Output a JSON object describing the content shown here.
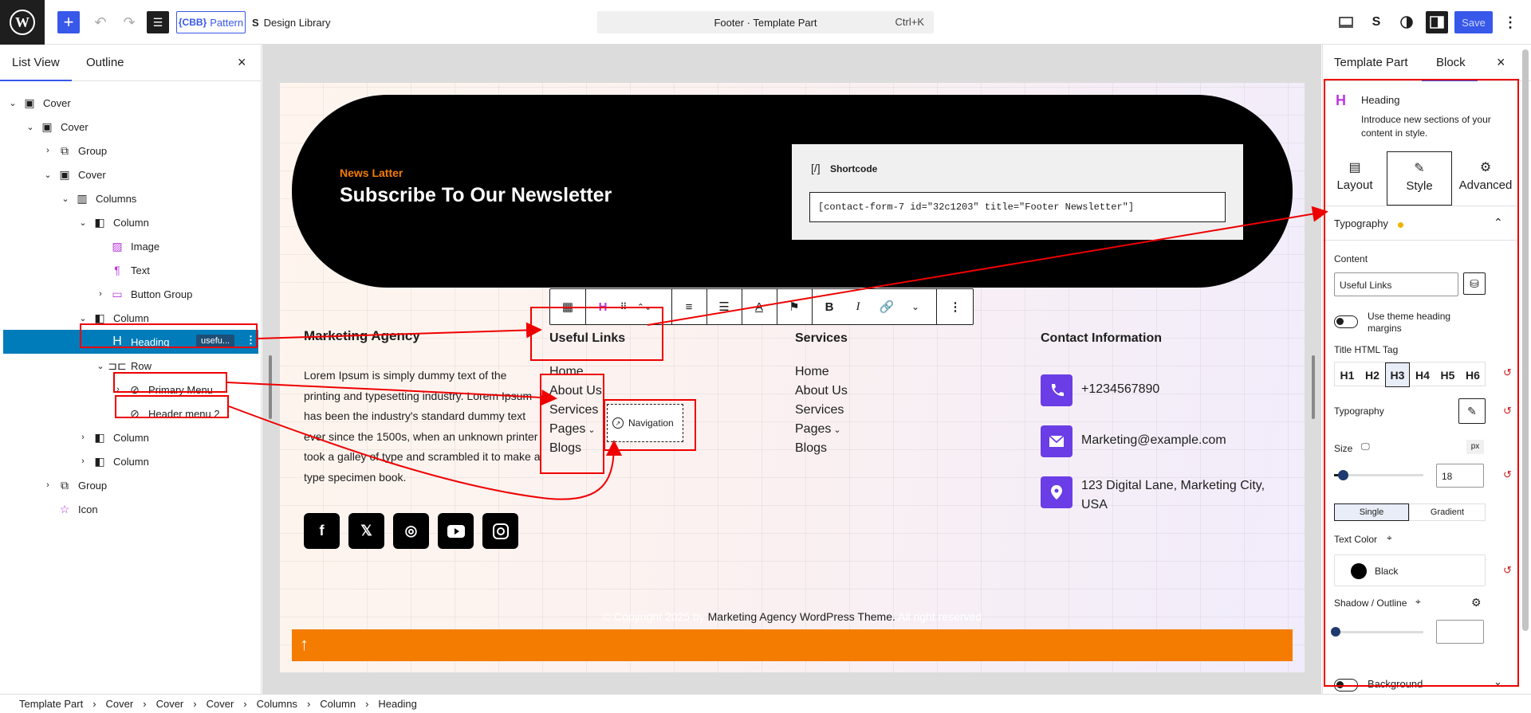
{
  "topbar": {
    "pattern_label": "Pattern",
    "pattern_badge": "{CBB}",
    "design_library": "Design Library",
    "command": {
      "title": "Footer · Template Part",
      "shortcut": "Ctrl+K"
    },
    "save_label": "Save"
  },
  "left_panel": {
    "tabs": [
      "List View",
      "Outline"
    ],
    "items": [
      {
        "label": "Cover",
        "chev": "⌄",
        "icon": "cover-icon"
      },
      {
        "label": "Cover",
        "chev": "⌄",
        "icon": "cover-icon"
      },
      {
        "label": "Group",
        "chev": "›",
        "icon": "group-icon"
      },
      {
        "label": "Cover",
        "chev": "⌄",
        "icon": "cover-icon"
      },
      {
        "label": "Columns",
        "chev": "⌄",
        "icon": "columns-icon"
      },
      {
        "label": "Column",
        "chev": "⌄",
        "icon": "column-icon"
      },
      {
        "label": "Image",
        "chev": "",
        "icon": "image-icon"
      },
      {
        "label": "Text",
        "chev": "",
        "icon": "paragraph-icon"
      },
      {
        "label": "Button Group",
        "chev": "›",
        "icon": "button-group-icon"
      },
      {
        "label": "Column",
        "chev": "⌄",
        "icon": "column-icon"
      },
      {
        "label": "Heading",
        "chev": "",
        "icon": "heading-icon",
        "badge": "usefu..."
      },
      {
        "label": "Row",
        "chev": "⌄",
        "icon": "row-icon"
      },
      {
        "label": "Primary Menu",
        "chev": "›",
        "icon": "navigation-icon"
      },
      {
        "label": "Header menu 2",
        "chev": "",
        "icon": "navigation-icon"
      },
      {
        "label": "Column",
        "chev": "›",
        "icon": "column-icon"
      },
      {
        "label": "Column",
        "chev": "›",
        "icon": "column-icon"
      },
      {
        "label": "Group",
        "chev": "›",
        "icon": "group-icon"
      },
      {
        "label": "Icon",
        "chev": "",
        "icon": "star-icon"
      }
    ]
  },
  "canvas": {
    "newsletter": {
      "kicker": "News Latter",
      "title": "Subscribe To Our Newsletter",
      "shortcode_label": "Shortcode",
      "shortcode_value": "[contact-form-7 id=\"32c1203\" title=\"Footer Newsletter\"]"
    },
    "about": {
      "heading": "Marketing Agency",
      "text": "Lorem Ipsum is simply dummy text of the printing and typesetting industry. Lorem Ipsum has been the industry's standard dummy text ever since the 1500s, when an unknown printer took a galley of type and scrambled it to make a type specimen book."
    },
    "useful_links": {
      "heading": "Useful Links",
      "items": [
        "Home",
        "About Us",
        "Services",
        "Pages",
        "Blogs"
      ],
      "nav_placeholder": "Navigation"
    },
    "services": {
      "heading": "Services",
      "items": [
        "Home",
        "About Us",
        "Services",
        "Pages",
        "Blogs"
      ]
    },
    "contact": {
      "heading": "Contact Information",
      "phone": "+1234567890",
      "email": "Marketing@example.com",
      "address": "123 Digital Lane, Marketing City, USA"
    },
    "copyright": {
      "prefix": "© Copyright 2025 by",
      "link": "Marketing Agency WordPress Theme.",
      "suffix": "All right reserved"
    }
  },
  "right_panel": {
    "tabs": [
      "Template Part",
      "Block"
    ],
    "block": {
      "name": "Heading",
      "description": "Introduce new sections of your content in style."
    },
    "subtabs": [
      "Layout",
      "Style",
      "Advanced"
    ],
    "typography_section": "Typography",
    "content_label": "Content",
    "content_value": "Useful Links",
    "theme_margins_label": "Use theme heading margins",
    "title_tag_label": "Title HTML Tag",
    "tags": [
      "H1",
      "H2",
      "H3",
      "H4",
      "H5",
      "H6"
    ],
    "selected_tag": "H3",
    "typography_label": "Typography",
    "size_label": "Size",
    "size_unit": "px",
    "size_value": "18",
    "size_fraction": 0.1,
    "color_modes": [
      "Single",
      "Gradient"
    ],
    "text_color_label": "Text Color",
    "text_color_value": "Black",
    "shadow_label": "Shadow / Outline",
    "background_label": "Background"
  },
  "breadcrumb": [
    "Template Part",
    "Cover",
    "Cover",
    "Cover",
    "Columns",
    "Column",
    "Heading"
  ],
  "colors": {
    "accent": "#007cba",
    "wp_blue": "#3858e9",
    "orange": "#f47c00",
    "purple": "#6b3de6",
    "highlight_red": "#e00000"
  }
}
